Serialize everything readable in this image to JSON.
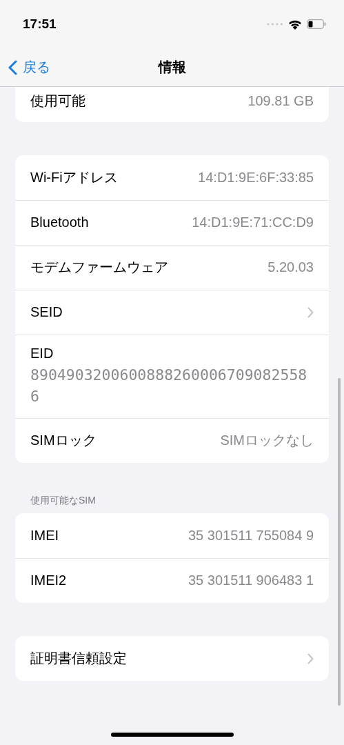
{
  "status_bar": {
    "time": "17:51"
  },
  "nav": {
    "back": "戻る",
    "title": "情報"
  },
  "sections": [
    {
      "rows": [
        {
          "kind": "value",
          "label": "使用可能",
          "value": "109.81 GB"
        }
      ]
    },
    {
      "rows": [
        {
          "kind": "value",
          "label": "Wi-Fiアドレス",
          "value": "14:D1:9E:6F:33:85"
        },
        {
          "kind": "value",
          "label": "Bluetooth",
          "value": "14:D1:9E:71:CC:D9"
        },
        {
          "kind": "value",
          "label": "モデムファームウェア",
          "value": "5.20.03"
        },
        {
          "kind": "chevron",
          "label": "SEID"
        },
        {
          "kind": "stacked",
          "label": "EID",
          "value": "89049032006008882600067090825586"
        },
        {
          "kind": "value",
          "label": "SIMロック",
          "value": "SIMロックなし"
        }
      ]
    },
    {
      "header": "使用可能なSIM",
      "rows": [
        {
          "kind": "value",
          "label": "IMEI",
          "value": "35 301511 755084 9"
        },
        {
          "kind": "value",
          "label": "IMEI2",
          "value": "35 301511 906483 1"
        }
      ]
    },
    {
      "rows": [
        {
          "kind": "chevron",
          "label": "証明書信頼設定"
        }
      ]
    }
  ]
}
